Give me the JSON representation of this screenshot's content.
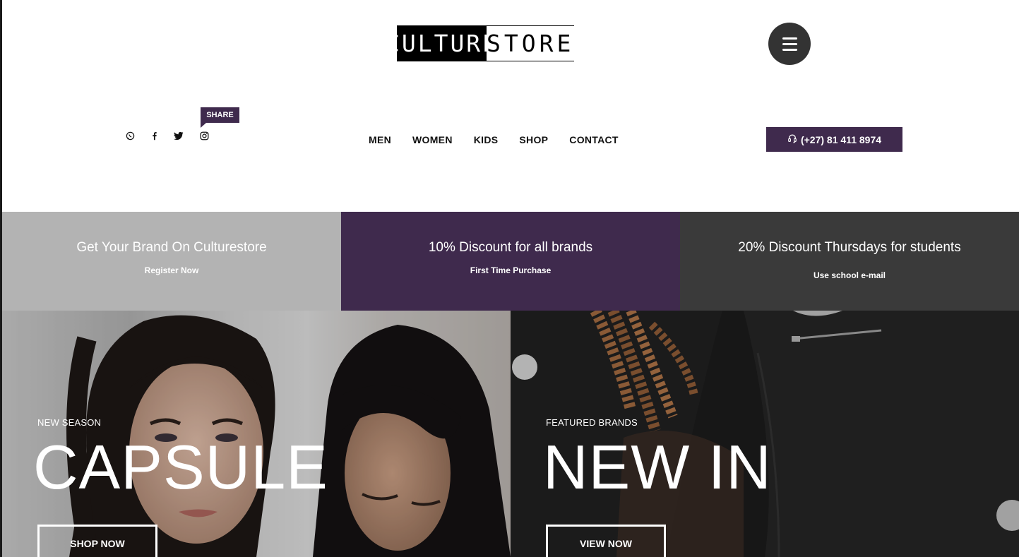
{
  "header": {
    "logo": {
      "part1": "CULTURE",
      "part2": "STORE"
    },
    "share_label": "SHARE",
    "social_icons": [
      "whatsapp-icon",
      "facebook-icon",
      "twitter-icon",
      "instagram-icon"
    ],
    "nav": [
      "MEN",
      "WOMEN",
      "KIDS",
      "SHOP",
      "CONTACT"
    ],
    "phone": "(+27) 81 411 8974"
  },
  "promos": [
    {
      "title": "Get Your Brand On Culturestore",
      "subtitle": "Register Now",
      "bg": "#b3b3b3"
    },
    {
      "title": "10% Discount for all brands",
      "subtitle": "First Time Purchase",
      "bg": "#3f2a4d"
    },
    {
      "title": "20% Discount Thursdays for students",
      "subtitle": "Use school e-mail",
      "bg": "#3a3a3a"
    }
  ],
  "heroes": [
    {
      "eyebrow": "NEW SEASON",
      "headline": "CAPSULE",
      "cta": "SHOP NOW"
    },
    {
      "eyebrow": "FEATURED BRANDS",
      "headline": "NEW IN",
      "cta": "VIEW NOW"
    }
  ],
  "colors": {
    "accent": "#3f2a4d",
    "dark": "#333333"
  }
}
